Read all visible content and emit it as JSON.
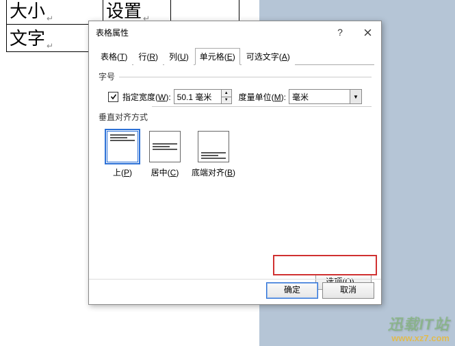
{
  "bg_table": {
    "r1c1": "大小",
    "r1c2": "设置",
    "r2c1": "文字"
  },
  "dialog": {
    "title": "表格属性",
    "tabs": {
      "table": "表格(",
      "table_key": "T",
      "row": "行(",
      "row_key": "R",
      "column": "列(",
      "column_key": "U",
      "cell": "单元格(",
      "cell_key": "E",
      "alt_text": "可选文字(",
      "alt_text_key": "A",
      "close_paren": ")"
    },
    "size_group": "字号",
    "pref_width_label_pre": "指定宽度(",
    "pref_width_key": "W",
    "pref_width_label_post": "):",
    "pref_width_value": "50.1 毫米",
    "measure_label_pre": "度量单位(",
    "measure_key": "M",
    "measure_label_post": "):",
    "measure_value": "毫米",
    "valign_group": "垂直对齐方式",
    "align_top_pre": "上(",
    "align_top_key": "P",
    "align_center_pre": "居中(",
    "align_center_key": "C",
    "align_bottom_pre": "底端对齐(",
    "align_bottom_key": "B",
    "options_pre": "选项(",
    "options_key": "O",
    "options_post": ")...",
    "ok": "确定",
    "cancel": "取消",
    "help_symbol": "?"
  },
  "watermark": {
    "line1": "迅载IT站",
    "line2": "www.xz7.com"
  }
}
